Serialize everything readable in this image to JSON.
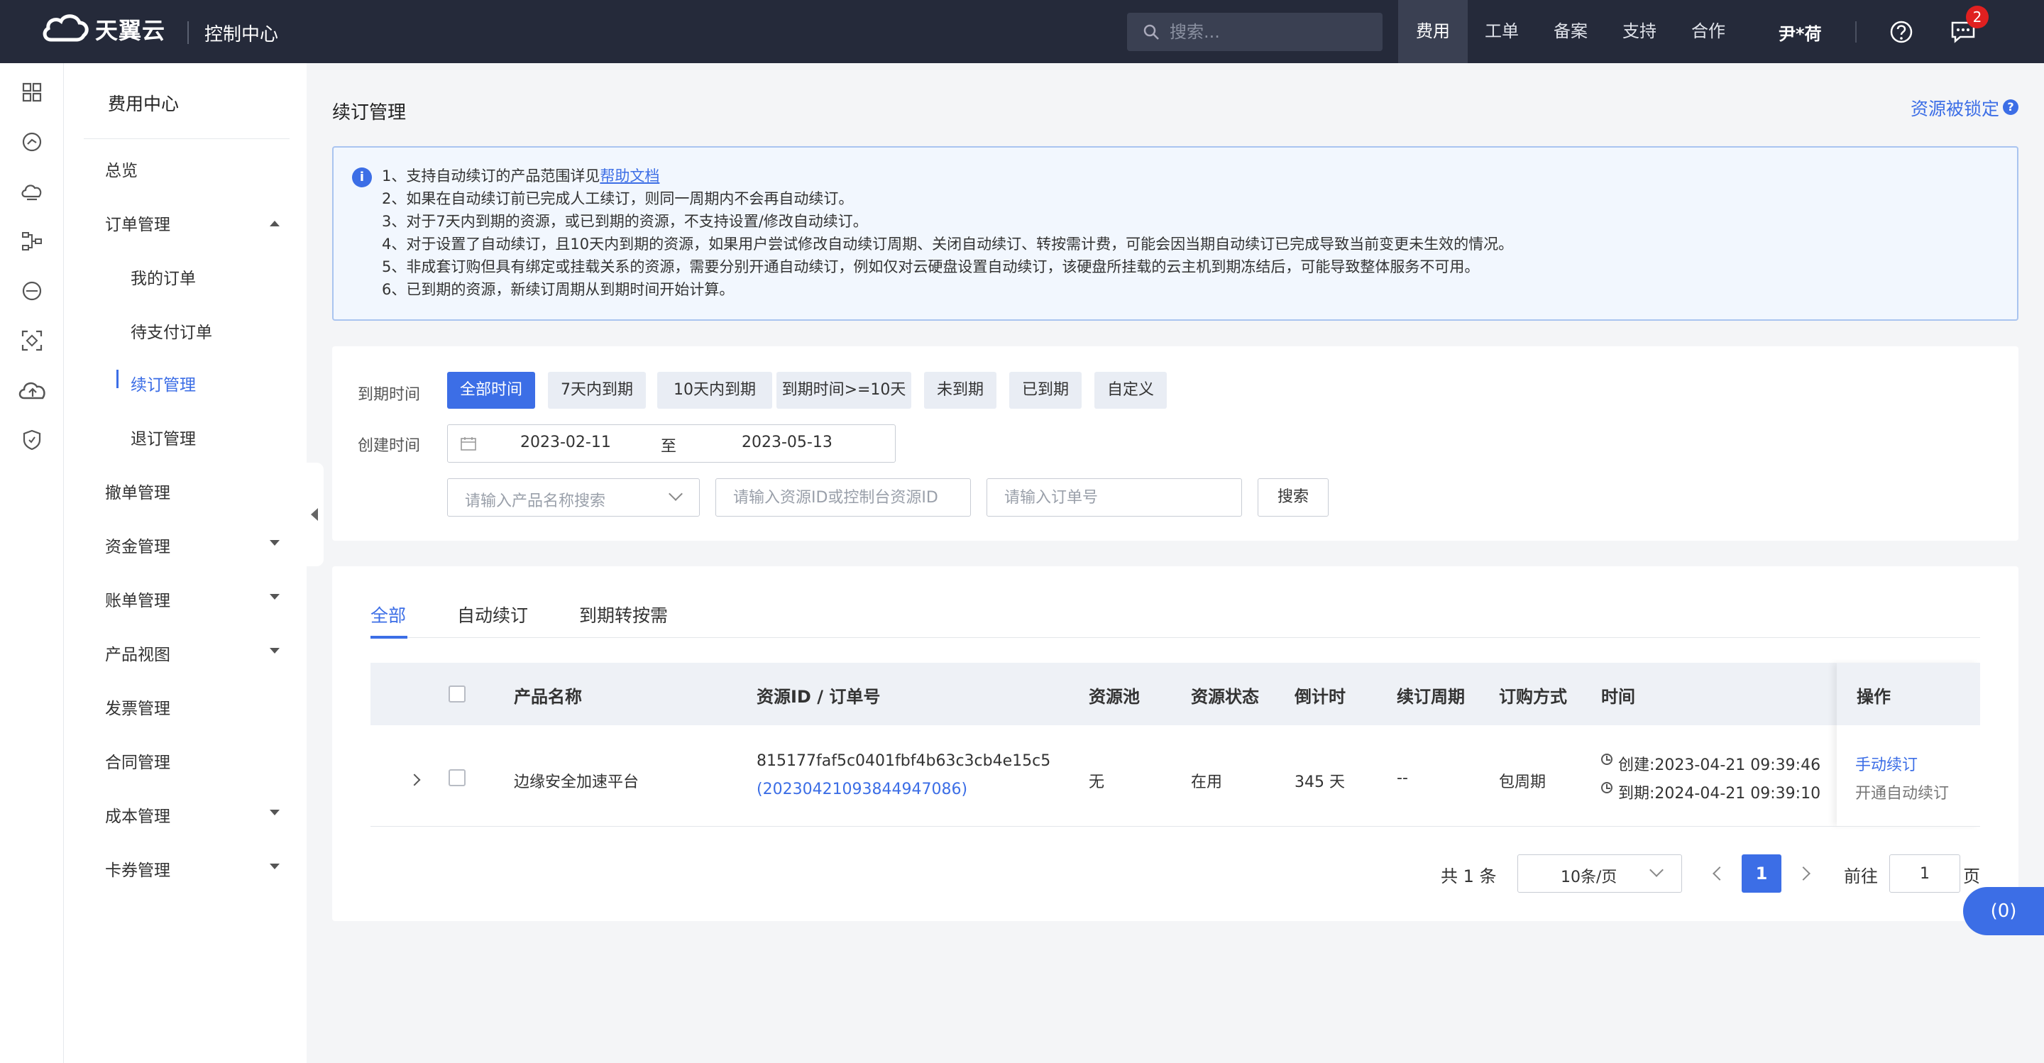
{
  "header": {
    "brand": "天翼云",
    "console_title": "控制中心",
    "search_placeholder": "搜索...",
    "nav": [
      "费用",
      "工单",
      "备案",
      "支持",
      "合作"
    ],
    "user": "尹*荷",
    "message_count": "2"
  },
  "sidebar": {
    "title": "费用中心",
    "items": [
      {
        "label": "总览"
      },
      {
        "label": "订单管理"
      },
      {
        "label": "我的订单"
      },
      {
        "label": "待支付订单"
      },
      {
        "label": "续订管理"
      },
      {
        "label": "退订管理"
      },
      {
        "label": "撤单管理"
      },
      {
        "label": "资金管理"
      },
      {
        "label": "账单管理"
      },
      {
        "label": "产品视图"
      },
      {
        "label": "发票管理"
      },
      {
        "label": "合同管理"
      },
      {
        "label": "成本管理"
      },
      {
        "label": "卡券管理"
      }
    ]
  },
  "page": {
    "title": "续订管理",
    "lock_link": "资源被锁定",
    "lock_q": "?",
    "info_glyph": "i"
  },
  "notice": {
    "line1_prefix": "1、支持自动续订的产品范围详见",
    "line1_link": "帮助文档",
    "lines": [
      "2、如果在自动续订前已完成人工续订，则同一周期内不会再自动续订。",
      "3、对于7天内到期的资源，或已到期的资源，不支持设置/修改自动续订。",
      "4、对于设置了自动续订，且10天内到期的资源，如果用户尝试修改自动续订周期、关闭自动续订、转按需计费，可能会因当期自动续订已完成导致当前变更未生效的情况。",
      "5、非成套订购但具有绑定或挂载关系的资源，需要分别开通自动续订，例如仅对云硬盘设置自动续订，该硬盘所挂载的云主机到期冻结后，可能导致整体服务不可用。",
      "6、已到期的资源，新续订周期从到期时间开始计算。"
    ]
  },
  "filters": {
    "expire_label": "到期时间",
    "expire_options": [
      "全部时间",
      "7天内到期",
      "10天内到期",
      "到期时间>=10天",
      "未到期",
      "已到期",
      "自定义"
    ],
    "create_label": "创建时间",
    "date_from": "2023-02-11",
    "date_sep": "至",
    "date_to": "2023-05-13",
    "product_placeholder": "请输入产品名称搜索",
    "resource_placeholder": "请输入资源ID或控制台资源ID",
    "order_placeholder": "请输入订单号",
    "search_button": "搜索"
  },
  "tabs": [
    "全部",
    "自动续订",
    "到期转按需"
  ],
  "table": {
    "columns": [
      "产品名称",
      "资源ID / 订单号",
      "资源池",
      "资源状态",
      "倒计时",
      "续订周期",
      "订购方式",
      "时间",
      "操作"
    ],
    "rows": [
      {
        "product": "边缘安全加速平台",
        "resource_id": "815177faf5c0401fbf4b63c3cb4e15c5",
        "order_no": "(20230421093844947086)",
        "pool": "无",
        "status": "在用",
        "countdown": "345 天",
        "cycle": "--",
        "purchase": "包周期",
        "created": "创建:2023-04-21 09:39:46",
        "expires": "到期:2024-04-21 09:39:10",
        "action_primary": "手动续订",
        "action_secondary": "开通自动续订"
      }
    ]
  },
  "pagination": {
    "total": "共 1 条",
    "page_size": "10条/页",
    "current": "1",
    "goto_label": "前往",
    "goto_value": "1",
    "goto_suffix": "页"
  },
  "float_badge": "(0)",
  "colors": {
    "accent": "#3c6ee6",
    "header_bg": "#252a3a"
  }
}
